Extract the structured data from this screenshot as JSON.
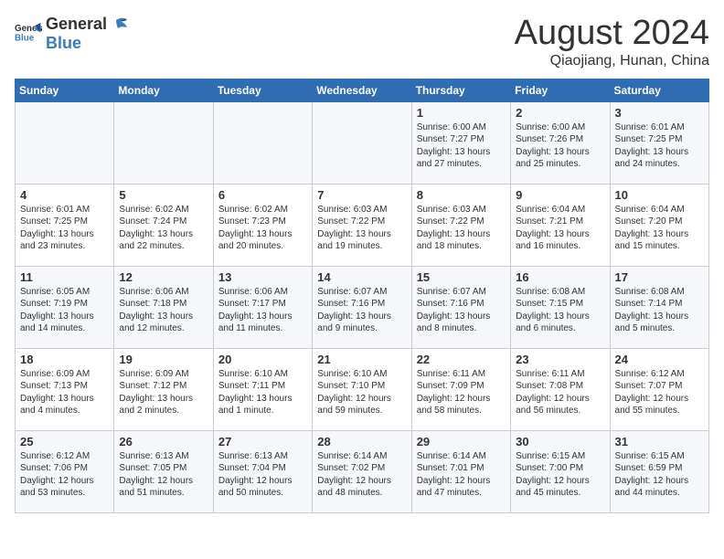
{
  "logo": {
    "general": "General",
    "blue": "Blue"
  },
  "title": "August 2024",
  "subtitle": "Qiaojiang, Hunan, China",
  "weekdays": [
    "Sunday",
    "Monday",
    "Tuesday",
    "Wednesday",
    "Thursday",
    "Friday",
    "Saturday"
  ],
  "weeks": [
    [
      {
        "day": "",
        "content": ""
      },
      {
        "day": "",
        "content": ""
      },
      {
        "day": "",
        "content": ""
      },
      {
        "day": "",
        "content": ""
      },
      {
        "day": "1",
        "content": "Sunrise: 6:00 AM\nSunset: 7:27 PM\nDaylight: 13 hours\nand 27 minutes."
      },
      {
        "day": "2",
        "content": "Sunrise: 6:00 AM\nSunset: 7:26 PM\nDaylight: 13 hours\nand 25 minutes."
      },
      {
        "day": "3",
        "content": "Sunrise: 6:01 AM\nSunset: 7:25 PM\nDaylight: 13 hours\nand 24 minutes."
      }
    ],
    [
      {
        "day": "4",
        "content": "Sunrise: 6:01 AM\nSunset: 7:25 PM\nDaylight: 13 hours\nand 23 minutes."
      },
      {
        "day": "5",
        "content": "Sunrise: 6:02 AM\nSunset: 7:24 PM\nDaylight: 13 hours\nand 22 minutes."
      },
      {
        "day": "6",
        "content": "Sunrise: 6:02 AM\nSunset: 7:23 PM\nDaylight: 13 hours\nand 20 minutes."
      },
      {
        "day": "7",
        "content": "Sunrise: 6:03 AM\nSunset: 7:22 PM\nDaylight: 13 hours\nand 19 minutes."
      },
      {
        "day": "8",
        "content": "Sunrise: 6:03 AM\nSunset: 7:22 PM\nDaylight: 13 hours\nand 18 minutes."
      },
      {
        "day": "9",
        "content": "Sunrise: 6:04 AM\nSunset: 7:21 PM\nDaylight: 13 hours\nand 16 minutes."
      },
      {
        "day": "10",
        "content": "Sunrise: 6:04 AM\nSunset: 7:20 PM\nDaylight: 13 hours\nand 15 minutes."
      }
    ],
    [
      {
        "day": "11",
        "content": "Sunrise: 6:05 AM\nSunset: 7:19 PM\nDaylight: 13 hours\nand 14 minutes."
      },
      {
        "day": "12",
        "content": "Sunrise: 6:06 AM\nSunset: 7:18 PM\nDaylight: 13 hours\nand 12 minutes."
      },
      {
        "day": "13",
        "content": "Sunrise: 6:06 AM\nSunset: 7:17 PM\nDaylight: 13 hours\nand 11 minutes."
      },
      {
        "day": "14",
        "content": "Sunrise: 6:07 AM\nSunset: 7:16 PM\nDaylight: 13 hours\nand 9 minutes."
      },
      {
        "day": "15",
        "content": "Sunrise: 6:07 AM\nSunset: 7:16 PM\nDaylight: 13 hours\nand 8 minutes."
      },
      {
        "day": "16",
        "content": "Sunrise: 6:08 AM\nSunset: 7:15 PM\nDaylight: 13 hours\nand 6 minutes."
      },
      {
        "day": "17",
        "content": "Sunrise: 6:08 AM\nSunset: 7:14 PM\nDaylight: 13 hours\nand 5 minutes."
      }
    ],
    [
      {
        "day": "18",
        "content": "Sunrise: 6:09 AM\nSunset: 7:13 PM\nDaylight: 13 hours\nand 4 minutes."
      },
      {
        "day": "19",
        "content": "Sunrise: 6:09 AM\nSunset: 7:12 PM\nDaylight: 13 hours\nand 2 minutes."
      },
      {
        "day": "20",
        "content": "Sunrise: 6:10 AM\nSunset: 7:11 PM\nDaylight: 13 hours\nand 1 minute."
      },
      {
        "day": "21",
        "content": "Sunrise: 6:10 AM\nSunset: 7:10 PM\nDaylight: 12 hours\nand 59 minutes."
      },
      {
        "day": "22",
        "content": "Sunrise: 6:11 AM\nSunset: 7:09 PM\nDaylight: 12 hours\nand 58 minutes."
      },
      {
        "day": "23",
        "content": "Sunrise: 6:11 AM\nSunset: 7:08 PM\nDaylight: 12 hours\nand 56 minutes."
      },
      {
        "day": "24",
        "content": "Sunrise: 6:12 AM\nSunset: 7:07 PM\nDaylight: 12 hours\nand 55 minutes."
      }
    ],
    [
      {
        "day": "25",
        "content": "Sunrise: 6:12 AM\nSunset: 7:06 PM\nDaylight: 12 hours\nand 53 minutes."
      },
      {
        "day": "26",
        "content": "Sunrise: 6:13 AM\nSunset: 7:05 PM\nDaylight: 12 hours\nand 51 minutes."
      },
      {
        "day": "27",
        "content": "Sunrise: 6:13 AM\nSunset: 7:04 PM\nDaylight: 12 hours\nand 50 minutes."
      },
      {
        "day": "28",
        "content": "Sunrise: 6:14 AM\nSunset: 7:02 PM\nDaylight: 12 hours\nand 48 minutes."
      },
      {
        "day": "29",
        "content": "Sunrise: 6:14 AM\nSunset: 7:01 PM\nDaylight: 12 hours\nand 47 minutes."
      },
      {
        "day": "30",
        "content": "Sunrise: 6:15 AM\nSunset: 7:00 PM\nDaylight: 12 hours\nand 45 minutes."
      },
      {
        "day": "31",
        "content": "Sunrise: 6:15 AM\nSunset: 6:59 PM\nDaylight: 12 hours\nand 44 minutes."
      }
    ]
  ]
}
